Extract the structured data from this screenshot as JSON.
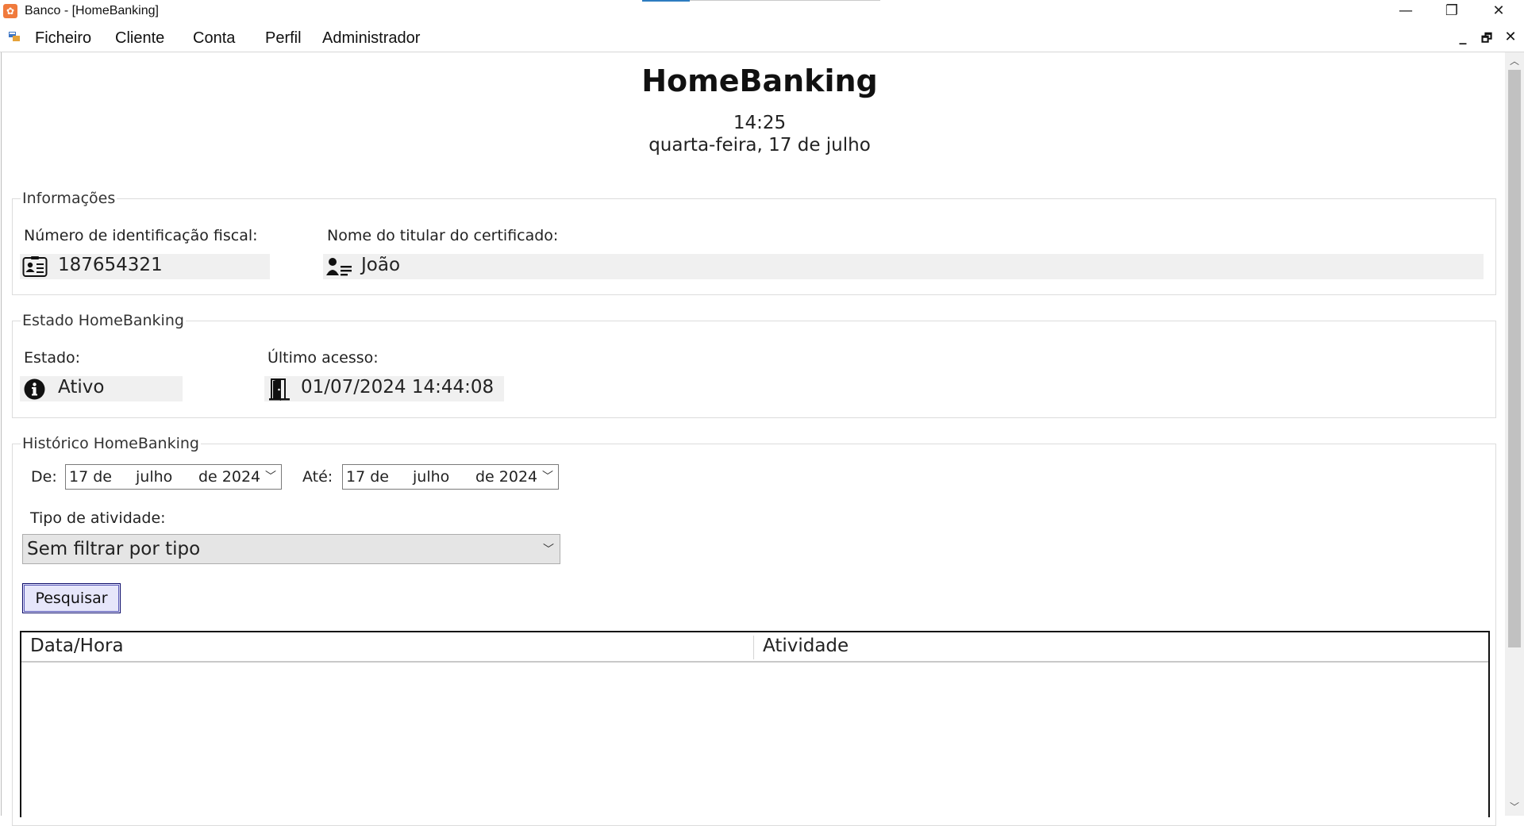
{
  "window": {
    "title": "Banco - [HomeBanking]",
    "controls": {
      "minimize": "—",
      "maximize": "❐",
      "close": "✕"
    }
  },
  "menu": {
    "items": [
      "Ficheiro",
      "Cliente",
      "Conta",
      "Perfil",
      "Administrador"
    ],
    "mdi_controls": {
      "minimize": "_",
      "restore": "🗗",
      "close": "✕"
    }
  },
  "header": {
    "title": "HomeBanking",
    "time": "14:25",
    "date": "quarta-feira, 17 de julho"
  },
  "informacoes": {
    "legend": "Informações",
    "nif_label": "Número de identificação fiscal:",
    "nif_value": "187654321",
    "nif_icon": "id-card-icon",
    "titular_label": "Nome do titular do certificado:",
    "titular_value": "João",
    "titular_icon": "user-list-icon"
  },
  "estado": {
    "legend": "Estado HomeBanking",
    "estado_label": "Estado:",
    "estado_value": "Ativo",
    "estado_icon": "info-icon",
    "acesso_label": "Último acesso:",
    "acesso_value": "01/07/2024 14:44:08",
    "acesso_icon": "door-icon"
  },
  "historico": {
    "legend": "Histórico HomeBanking",
    "de_label": "De:",
    "de_date": {
      "day": "17 de",
      "month": "julho",
      "year": "de 2024"
    },
    "ate_label": "Até:",
    "ate_date": {
      "day": "17 de",
      "month": "julho",
      "year": "de 2024"
    },
    "tipo_label": "Tipo de atividade:",
    "tipo_value": "Sem filtrar por tipo",
    "search_button": "Pesquisar",
    "columns": [
      "Data/Hora",
      "Atividade"
    ],
    "rows": []
  },
  "colors": {
    "app_icon": "#f07a3c",
    "button_bg": "#e6e6fa",
    "readonly_bg": "#f0f0f0"
  }
}
